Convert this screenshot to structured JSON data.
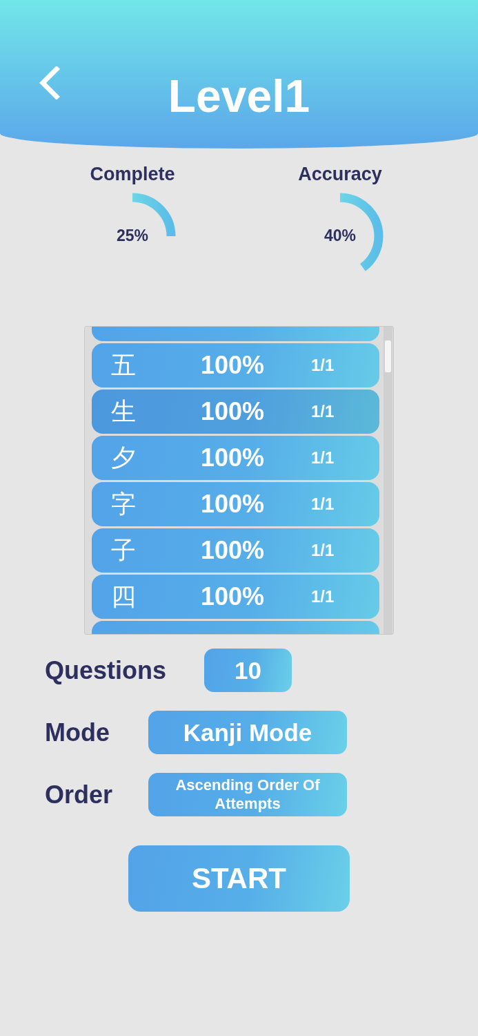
{
  "header": {
    "title": "Level1"
  },
  "stats": [
    {
      "label": "Complete",
      "reading": "25%",
      "level": 0.25
    },
    {
      "label": "Accuracy",
      "reading": "40%",
      "level": 0.4
    }
  ],
  "kanji_list": [
    {
      "kanji": "五",
      "accuracy": "100%",
      "attempts": "1/1",
      "selected": false
    },
    {
      "kanji": "生",
      "accuracy": "100%",
      "attempts": "1/1",
      "selected": true
    },
    {
      "kanji": "夕",
      "accuracy": "100%",
      "attempts": "1/1",
      "selected": false
    },
    {
      "kanji": "字",
      "accuracy": "100%",
      "attempts": "1/1",
      "selected": false
    },
    {
      "kanji": "子",
      "accuracy": "100%",
      "attempts": "1/1",
      "selected": false
    },
    {
      "kanji": "四",
      "accuracy": "100%",
      "attempts": "1/1",
      "selected": false
    }
  ],
  "settings": [
    {
      "kind": "questions",
      "label": "Questions",
      "value": "10"
    },
    {
      "kind": "mode",
      "label": "Mode",
      "value": "Kanji Mode"
    },
    {
      "kind": "order",
      "label": "Order",
      "value": "Ascending Order Of Attempts"
    }
  ],
  "start_button": "START"
}
